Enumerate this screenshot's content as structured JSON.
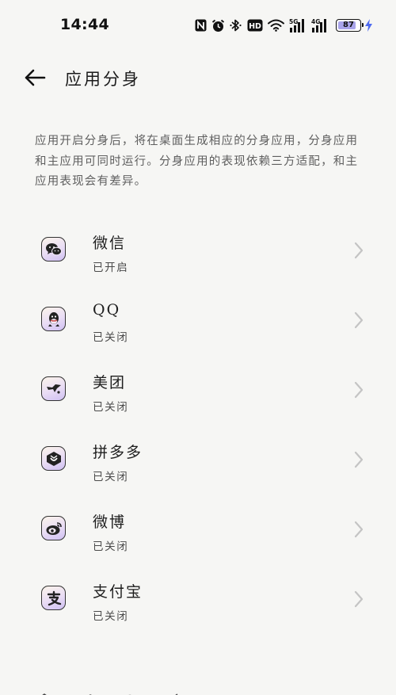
{
  "status_bar": {
    "time": "14:44",
    "battery_level": "87",
    "battery_level_fraction": 0.87,
    "network_labels": [
      "HD",
      "5G",
      "4G"
    ],
    "icons": [
      "nfc-icon",
      "alarm-icon",
      "bluetooth-icon",
      "hd-icon",
      "wifi-icon",
      "5g-signal-icon",
      "4g-signal-icon",
      "battery-icon",
      "charging-icon"
    ],
    "accent_battery_color": "#a9a4ea",
    "charging_color": "#4f6bf0"
  },
  "header": {
    "title": "应用分身",
    "back_icon": "back-arrow-icon"
  },
  "description": "应用开启分身后，将在桌面生成相应的分身应用，分身应用和主应用可同时运行。分身应用的表现依赖三方适配，和主应用表现会有差异。",
  "apps": [
    {
      "name": "微信",
      "status": "已开启",
      "icon": "wechat-icon"
    },
    {
      "name": "QQ",
      "status": "已关闭",
      "icon": "qq-icon"
    },
    {
      "name": "美团",
      "status": "已关闭",
      "icon": "meituan-icon"
    },
    {
      "name": "拼多多",
      "status": "已关闭",
      "icon": "pinduoduo-icon"
    },
    {
      "name": "微博",
      "status": "已关闭",
      "icon": "weibo-icon"
    },
    {
      "name": "支付宝",
      "status": "已关闭",
      "icon": "alipay-icon"
    }
  ],
  "colors": {
    "background": "#f6f6f4",
    "text_primary": "#1e1e1e",
    "text_secondary": "#5f5f5f",
    "chevron": "#c4c4c4"
  }
}
